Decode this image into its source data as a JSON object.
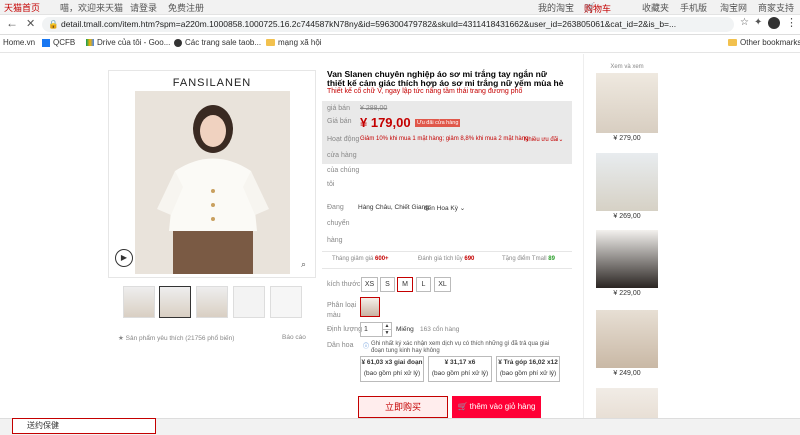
{
  "tmall_bar": {
    "home": "天猫首页",
    "greeting": "喵，欢迎来天猫",
    "login": "请登录",
    "register": "免费注册",
    "my_taobao": "我的淘宝",
    "cart": "购物车",
    "favorites": "收藏夹",
    "mobile": "手机版",
    "taobao": "淘宝网",
    "merchant": "商家支持"
  },
  "browser": {
    "url": "detail.tmall.com/item.htm?spm=a220m.1000858.1000725.16.2c744587kN78ny&id=596300479782&skuId=4311418431662&user_id=263805061&cat_id=2&is_b=...",
    "bookmarks": [
      "Home.vn",
      "QCFB",
      "Drive của tôi - Goo...",
      "Các trang sale taob...",
      "mạng xã hội"
    ],
    "other_bookmarks": "Other bookmarks"
  },
  "product": {
    "brand": "FANSILANEN",
    "title": "Van Slanen chuyên nghiệp áo sơ mi trắng tay ngắn nữ thiết kế cảm giác thích hợp áo sơ mi trắng nữ yếm mùa hè",
    "subtitle": "Thiết kế cổ chữ V, ngay lập tức nâng tầm thái trang đương phố",
    "orig_price_label": "giá bán",
    "orig_price": "¥ 288,00",
    "price_label": "Giá bán",
    "price": "¥ 179,00",
    "price_badge": "Ưu đãi cửa hàng",
    "promo_label": "Hoạt động",
    "promo_text": "Giảm 10% khi mua 1 mặt hàng; giảm 8,8% khi mua 2 mặt hàng",
    "promo_more": "Nhiều ưu đãi",
    "store_label_1": "cửa hàng",
    "store_label_2": "của chúng",
    "store_label_3": "tôi",
    "ship_label_1": "Đang",
    "ship_label_2": "chuyển",
    "ship_label_3": "hàng",
    "ship_from": "Hàng Châu, Chiết Giang",
    "ship_to": "đến Hoa Kỳ",
    "stats": [
      {
        "label": "Tháng giảm giá",
        "value": "600+"
      },
      {
        "label": "Đánh giá tích lũy",
        "value": "690"
      },
      {
        "label": "Tặng điểm Tmall",
        "value": "89"
      }
    ],
    "size_label": "kích thước",
    "sizes": [
      "XS",
      "S",
      "M",
      "L",
      "XL"
    ],
    "selected_size": "M",
    "color_label_1": "Phân loại",
    "color_label_2": "màu",
    "qty_label": "Định lượng",
    "qty_value": "1",
    "qty_unit": "Miếng",
    "stock": "163 cổn hàng",
    "installment_label": "Dân hoa",
    "installment_note": "Ghi nhất ký xác nhận xem dịch vụ có thích những gì đã trả qua giai đoạn tung kinh hay không",
    "installments": [
      {
        "line1": "¥ 61,03 x3 giai đoạn",
        "line2": "(bao gồm phí xử lý)"
      },
      {
        "line1": "¥ 31,17 x6",
        "line2": "(bao gồm phí xử lý)"
      },
      {
        "line1": "¥ Trả góp 16,02 x12",
        "line2": "(bao gồm phí xử lý)"
      }
    ],
    "buy_now": "立即购买",
    "add_cart": "thêm vào giỏ hàng",
    "fav_text": "Sản phẩm yêu thích (21756 phổ biến)",
    "report": "Báo cáo"
  },
  "sidebar": {
    "title": "Xem và xem",
    "prices": [
      "¥ 279,00",
      "¥ 269,00",
      "¥ 229,00",
      "¥ 249,00"
    ]
  },
  "bottom_search": {
    "text": "送约保健"
  }
}
